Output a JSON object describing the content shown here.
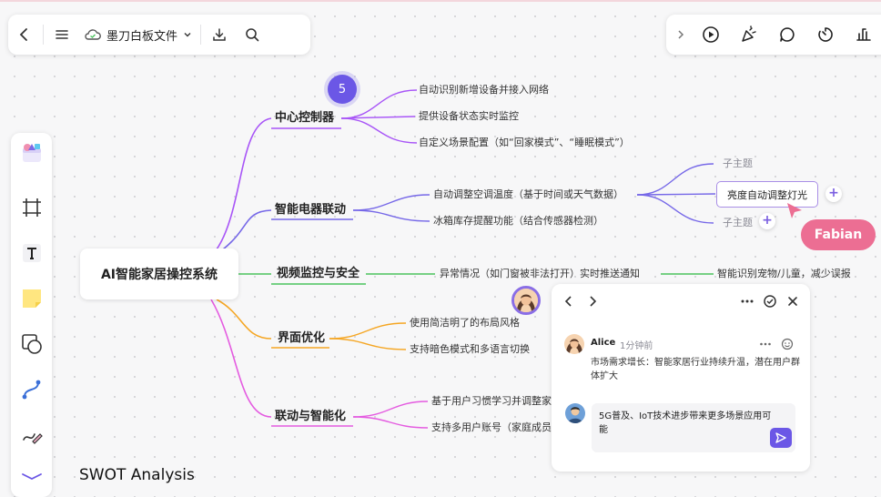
{
  "app": {
    "doc_title": "墨刀白板文件"
  },
  "colors": {
    "accent": "#6b57e6",
    "branch_purple": "#a855f7",
    "branch_indigo": "#7668e8",
    "branch_green": "#4cc45e",
    "branch_orange": "#f5a623",
    "branch_magenta": "#e45be0",
    "fabian_cursor": "#ec6e93"
  },
  "mindmap": {
    "root": "AI智能家居操控系统",
    "branches": [
      {
        "label": "中心控制器",
        "children": [
          "自动识别新增设备并接入网络",
          "提供设备状态实时监控",
          "自定义场景配置（如“回家模式”、“睡眠模式”）"
        ]
      },
      {
        "label": "智能电器联动",
        "children": [
          "自动调整空调温度（基于时间或天气数据）",
          "冰箱库存提醒功能（结合传感器检测）"
        ],
        "subtopics": [
          "子主题",
          "亮度自动调整灯光",
          "子主题"
        ]
      },
      {
        "label": "视频监控与安全",
        "children": [
          "异常情况（如门窗被非法打开）实时推送通知",
          "智能识别宠物/儿童，减少误报"
        ]
      },
      {
        "label": "界面优化",
        "children": [
          "使用简洁明了的布局风格",
          "支持暗色模式和多语言切换"
        ]
      },
      {
        "label": "联动与智能化",
        "children": [
          "基于用户习惯学习并调整家",
          "支持多用户账号（家庭成员"
        ]
      }
    ],
    "comment_count": "5"
  },
  "collaborator": {
    "name": "Fabian"
  },
  "comment_panel": {
    "comment": {
      "author": "Alice",
      "time": "1分钟前",
      "text": "市场需求增长：智能家居行业持续升温，潜在用户群体扩大"
    },
    "reply_draft": "5G普及、IoT技术进步带来更多场景应用可能"
  },
  "canvas_next_section": "SWOT Analysis",
  "icons": {
    "toolbar_left": [
      "back-icon",
      "menu-icon",
      "cloud-icon",
      "chevron-down-icon",
      "download-icon",
      "search-icon"
    ],
    "toolbar_right": [
      "expand-icon",
      "play-icon",
      "celebrate-icon",
      "comment-icon",
      "timer-icon",
      "chart-icon"
    ],
    "tools": [
      "template-icon",
      "frame-icon",
      "text-icon",
      "sticky-note-icon",
      "shape-icon",
      "connector-icon",
      "pen-icon",
      "mindmap-icon"
    ]
  }
}
